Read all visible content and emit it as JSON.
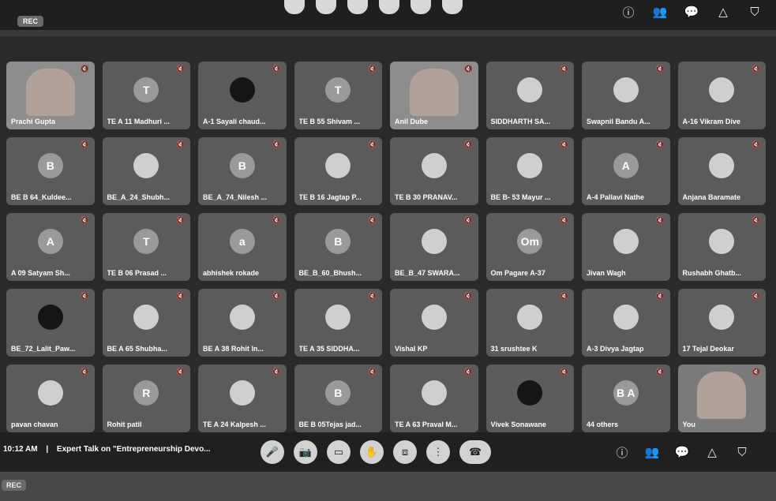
{
  "rec_label": "REC",
  "participants": [
    {
      "name": "Prachi Gupta",
      "initial": "",
      "kind": "video"
    },
    {
      "name": "TE A 11 Madhuri ...",
      "initial": "T",
      "kind": "avatar"
    },
    {
      "name": "A-1 Sayali chaud...",
      "initial": "",
      "kind": "dark"
    },
    {
      "name": "TE B 55 Shivam ...",
      "initial": "T",
      "kind": "avatar"
    },
    {
      "name": "Anil Dube",
      "initial": "",
      "kind": "video"
    },
    {
      "name": "SIDDHARTH SA...",
      "initial": "",
      "kind": "photo"
    },
    {
      "name": "Swapnil Bandu A...",
      "initial": "",
      "kind": "photo"
    },
    {
      "name": "A-16 Vikram Dive",
      "initial": "",
      "kind": "photo"
    },
    {
      "name": "BE B 64_Kuldee...",
      "initial": "B",
      "kind": "avatar"
    },
    {
      "name": "BE_A_24_Shubh...",
      "initial": "",
      "kind": "photo"
    },
    {
      "name": "BE_A_74_Nilesh ...",
      "initial": "B",
      "kind": "avatar"
    },
    {
      "name": "TE B 16 Jagtap P...",
      "initial": "",
      "kind": "photo"
    },
    {
      "name": "TE B 30 PRANAV...",
      "initial": "",
      "kind": "photo"
    },
    {
      "name": "BE B- 53 Mayur ...",
      "initial": "",
      "kind": "photo"
    },
    {
      "name": "A-4 Pallavi Nathe",
      "initial": "A",
      "kind": "avatar"
    },
    {
      "name": "Anjana Baramate",
      "initial": "",
      "kind": "photo"
    },
    {
      "name": "A 09 Satyam Sh...",
      "initial": "A",
      "kind": "avatar"
    },
    {
      "name": "TE B 06 Prasad ...",
      "initial": "T",
      "kind": "avatar"
    },
    {
      "name": "abhishek rokade",
      "initial": "a",
      "kind": "avatar"
    },
    {
      "name": "BE_B_60_Bhush...",
      "initial": "B",
      "kind": "avatar"
    },
    {
      "name": "BE_B_47 SWARA...",
      "initial": "",
      "kind": "photo"
    },
    {
      "name": "Om Pagare A-37",
      "initial": "Om",
      "kind": "avatar"
    },
    {
      "name": "Jivan Wagh",
      "initial": "",
      "kind": "photo"
    },
    {
      "name": "Rushabh Ghatb...",
      "initial": "",
      "kind": "photo"
    },
    {
      "name": "BE_72_Lalit_Paw...",
      "initial": "",
      "kind": "dark"
    },
    {
      "name": "BE A 65 Shubha...",
      "initial": "",
      "kind": "photo"
    },
    {
      "name": "BE A 38 Rohit In...",
      "initial": "",
      "kind": "photo"
    },
    {
      "name": "TE A 35 SIDDHA...",
      "initial": "",
      "kind": "photo"
    },
    {
      "name": "Vishal KP",
      "initial": "",
      "kind": "photo"
    },
    {
      "name": "31 srushtee K",
      "initial": "",
      "kind": "photo"
    },
    {
      "name": "A-3 Divya Jagtap",
      "initial": "",
      "kind": "photo"
    },
    {
      "name": "17 Tejal Deokar",
      "initial": "",
      "kind": "photo"
    },
    {
      "name": "pavan chavan",
      "initial": "",
      "kind": "photo"
    },
    {
      "name": "Rohit patil",
      "initial": "R",
      "kind": "avatar"
    },
    {
      "name": "TE A 24 Kalpesh ...",
      "initial": "",
      "kind": "photo"
    },
    {
      "name": "BE B 05Tejas jad...",
      "initial": "B",
      "kind": "avatar"
    },
    {
      "name": "TE A 63 Praval M...",
      "initial": "",
      "kind": "photo"
    },
    {
      "name": "Vivek Sonawane",
      "initial": "",
      "kind": "dark"
    },
    {
      "name": "44 others",
      "initial": "B A",
      "kind": "avatar"
    },
    {
      "name": "You",
      "initial": "",
      "kind": "you"
    }
  ],
  "bottom_bar": {
    "time": "10:12 AM",
    "separator": "|",
    "meeting_title": "Expert Talk on \"Entrepreneurship Devo...",
    "controls": [
      "mic",
      "camera",
      "captions",
      "raise-hand",
      "present",
      "more",
      "end-call"
    ]
  },
  "colors": {
    "tile": "#5b5b5b",
    "background": "#2a2a2a"
  }
}
